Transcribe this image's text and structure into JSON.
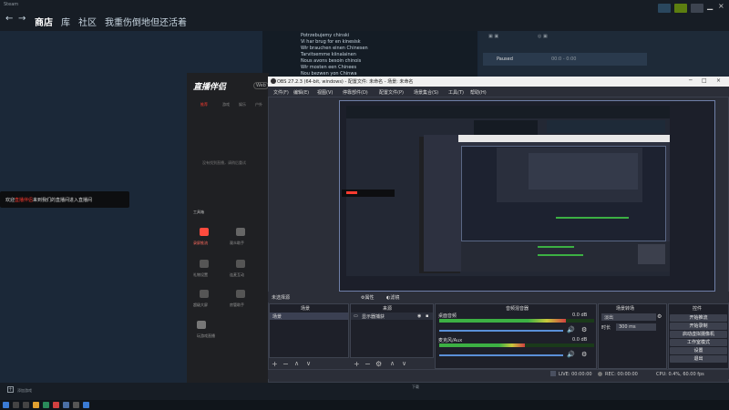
{
  "steam": {
    "menu_label": "Steam",
    "back_arrow": "←",
    "forward_arrow": "→",
    "tabs": [
      "商店",
      "库",
      "社区",
      "我重伤倒地但还活着"
    ],
    "chat_lines": [
      "Potrzebujemy chinski",
      "Vi har brug for en kinesisk",
      "Wir brauchen einen Chinesen",
      "Tarvitsemme kiinalainen",
      "Nous avons besoin chinois",
      "Wir mosten een Chinees",
      "Nou bezwen yon Chinwa"
    ],
    "friend_name": "Paused",
    "friend_status": "00:0 - 0:00",
    "add_game_label": "添加游戏",
    "downloads_label": "下载",
    "top_right_badge_color": "#5c7e10",
    "colors": {
      "bg": "#1b2838",
      "bar": "#171d25",
      "accent": "#66c0f4"
    }
  },
  "assistant": {
    "logo": "直播伴侣",
    "badge": "Web",
    "tabs": [
      "推荐",
      "游戏",
      "娱乐",
      "户外"
    ],
    "empty_hint": "没有找到直播，请稍后重试",
    "tools_title": "工具箱",
    "tools": [
      "录屏推流",
      "观众助手",
      "礼物设置",
      "连麦互动",
      "超级大屏",
      "房管助手"
    ],
    "game_item": "玩游戏直播",
    "toast_prefix": "欢迎",
    "toast_name": "直播伴侣",
    "toast_suffix": "来到我们的直播间进入直播间",
    "toast_highlight_color": "#ff3b30"
  },
  "obs": {
    "title": "OBS 27.2.3 (64-bit, windows) - 配置文件: 未命名 - 场景: 未命名",
    "menus": [
      "文件(F)",
      "编辑(E)",
      "视图(V)",
      "停靠部件(D)",
      "配置文件(P)",
      "场景集合(S)",
      "工具(T)",
      "帮助(H)"
    ],
    "source_bar": {
      "no_source": "未选择源",
      "props": "属性",
      "filter": "滤镜"
    },
    "scenes_header": "场景",
    "scene_item": "场景",
    "sources_header": "来源",
    "source_item": "显示器捕获",
    "mixer_header": "音频混音器",
    "mixer_tracks": [
      {
        "name": "桌面音频",
        "db": "0.0 dB",
        "level": 0.82
      },
      {
        "name": "麦克风/Aux",
        "db": "0.0 dB",
        "level": 0.55
      }
    ],
    "transitions_header": "场景转场",
    "transition_type": "淡出",
    "duration_label": "时长",
    "duration_value": "300 ms",
    "controls_header": "控件",
    "controls": [
      "开始推流",
      "开始录制",
      "启动虚拟摄像机",
      "工作室模式",
      "设置",
      "退出"
    ],
    "status": {
      "live": "LIVE: 00:00:00",
      "rec": "REC: 00:00:00",
      "cpu": "CPU: 0.4%, 60.00 fps",
      "frames": "00:00:00"
    },
    "colors": {
      "bg": "#2b2e38",
      "panel": "#1e2029",
      "meter_green": "#3cb043",
      "meter_yellow": "#c8c83c",
      "meter_red": "#d04040"
    }
  }
}
